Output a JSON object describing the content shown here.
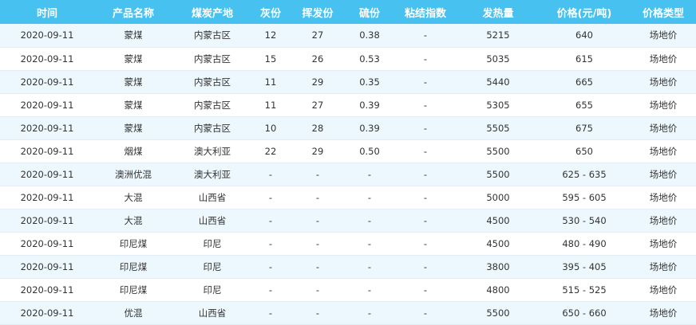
{
  "table": {
    "headers": [
      "时间",
      "产品名称",
      "煤炭产地",
      "灰份",
      "挥发份",
      "硫份",
      "粘结指数",
      "发热量",
      "价格(元/吨)",
      "价格类型"
    ],
    "rows": [
      [
        "2020-09-11",
        "蒙煤",
        "内蒙古区",
        "12",
        "27",
        "0.38",
        "-",
        "5215",
        "640",
        "场地价"
      ],
      [
        "2020-09-11",
        "蒙煤",
        "内蒙古区",
        "15",
        "26",
        "0.53",
        "-",
        "5035",
        "615",
        "场地价"
      ],
      [
        "2020-09-11",
        "蒙煤",
        "内蒙古区",
        "11",
        "29",
        "0.35",
        "-",
        "5440",
        "665",
        "场地价"
      ],
      [
        "2020-09-11",
        "蒙煤",
        "内蒙古区",
        "11",
        "27",
        "0.39",
        "-",
        "5305",
        "655",
        "场地价"
      ],
      [
        "2020-09-11",
        "蒙煤",
        "内蒙古区",
        "10",
        "28",
        "0.39",
        "-",
        "5505",
        "675",
        "场地价"
      ],
      [
        "2020-09-11",
        "烟煤",
        "澳大利亚",
        "22",
        "29",
        "0.50",
        "-",
        "5500",
        "650",
        "场地价"
      ],
      [
        "2020-09-11",
        "澳洲优混",
        "澳大利亚",
        "-",
        "-",
        "-",
        "-",
        "5500",
        "625 - 635",
        "场地价"
      ],
      [
        "2020-09-11",
        "大混",
        "山西省",
        "-",
        "-",
        "-",
        "-",
        "5000",
        "595 - 605",
        "场地价"
      ],
      [
        "2020-09-11",
        "大混",
        "山西省",
        "-",
        "-",
        "-",
        "-",
        "4500",
        "530 - 540",
        "场地价"
      ],
      [
        "2020-09-11",
        "印尼煤",
        "印尼",
        "-",
        "-",
        "-",
        "-",
        "4500",
        "480 - 490",
        "场地价"
      ],
      [
        "2020-09-11",
        "印尼煤",
        "印尼",
        "-",
        "-",
        "-",
        "-",
        "3800",
        "395 - 405",
        "场地价"
      ],
      [
        "2020-09-11",
        "印尼煤",
        "印尼",
        "-",
        "-",
        "-",
        "-",
        "4800",
        "515 - 525",
        "场地价"
      ],
      [
        "2020-09-11",
        "优混",
        "山西省",
        "-",
        "-",
        "-",
        "-",
        "5500",
        "650 - 660",
        "场地价"
      ]
    ]
  },
  "colors": {
    "header_bg": "#46c1f0",
    "header_text": "#ffffff",
    "row_stripe": "#edf8fe"
  }
}
